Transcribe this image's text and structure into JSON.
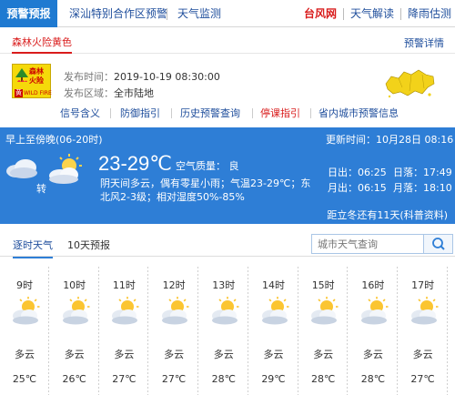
{
  "topnav": {
    "active_tab": "预警预报",
    "shenshan": "深汕特别合作区预警",
    "monitor": "天气监测",
    "typhoon": "台风网",
    "interpret": "天气解读",
    "rain": "降雨估测"
  },
  "warning": {
    "title": "森林火险黄色",
    "detail_link": "预警详情",
    "icon": {
      "label_cn": "森林火险",
      "level_cn": "黄",
      "label_en": "WILD FIRE",
      "color": "#f5d90a"
    },
    "publish_time_label": "发布时间：",
    "publish_time": "2019-10-19 08:30:00",
    "area_label": "发布区域：",
    "area": "全市陆地",
    "links": [
      "信号含义",
      "防御指引",
      "历史预警查询",
      "停课指引",
      "省内城市预警信息"
    ]
  },
  "forecast": {
    "period": "早上至傍晚(06-20时)",
    "update_label": "更新时间：",
    "update_time": "10月28日 08:16",
    "temp": "23-29℃",
    "air_quality": "空气质量：  良",
    "transition": "转",
    "description": "阴天间多云，偶有零星小雨；气温23-29℃；东北风2-3级；相对湿度50%-85%",
    "sunrise_label": "日出：",
    "sunrise": "06:25",
    "sunset_label": "日落：",
    "sunset": "17:49",
    "moonrise_label": "月出：",
    "moonrise": "06:15",
    "moonset_label": "月落：",
    "moonset": "18:10",
    "solar_term": "距立冬还有11天(科普资料)",
    "bg_color": "#2e7ed6"
  },
  "tabs": {
    "hourly": "逐时天气",
    "ten_day": "10天预报"
  },
  "search": {
    "placeholder": "城市天气查询",
    "icon": "search-icon"
  },
  "hourly": [
    {
      "time": "9时",
      "desc": "多云",
      "temp": "25℃"
    },
    {
      "time": "10时",
      "desc": "多云",
      "temp": "26℃"
    },
    {
      "time": "11时",
      "desc": "多云",
      "temp": "27℃"
    },
    {
      "time": "12时",
      "desc": "多云",
      "temp": "27℃"
    },
    {
      "time": "13时",
      "desc": "多云",
      "temp": "28℃"
    },
    {
      "time": "14时",
      "desc": "多云",
      "temp": "29℃"
    },
    {
      "time": "15时",
      "desc": "多云",
      "temp": "28℃"
    },
    {
      "time": "16时",
      "desc": "多云",
      "temp": "28℃"
    },
    {
      "time": "17时",
      "desc": "多云",
      "temp": "27℃"
    }
  ]
}
